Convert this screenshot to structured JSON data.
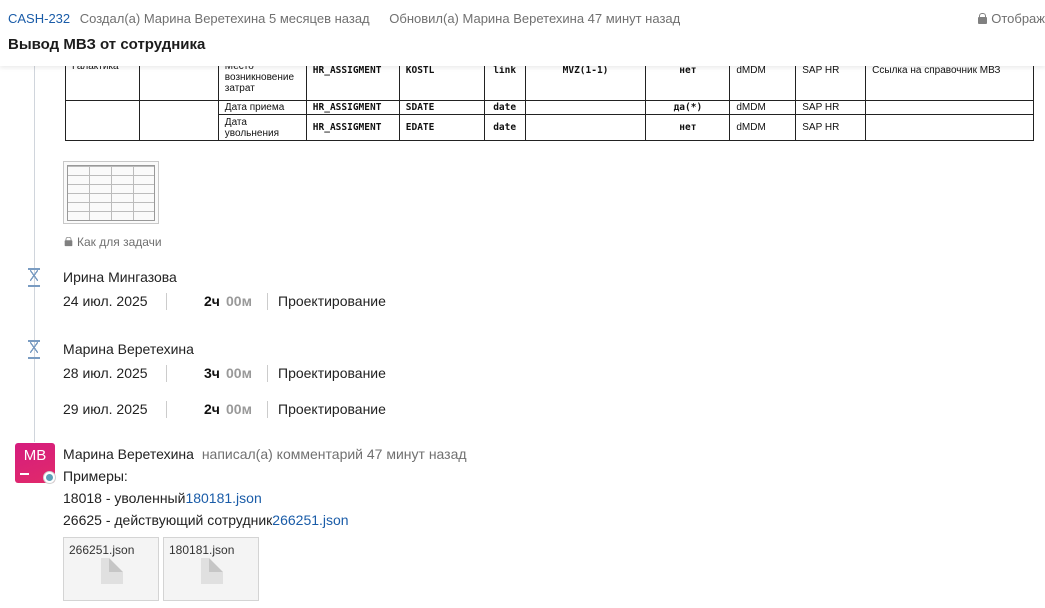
{
  "header": {
    "issue_key": "CASH-232",
    "created": "Создал(а) Марина Веретехина 5 месяцев назад",
    "updated": "Обновил(а) Марина Веретехина 47 минут назад",
    "visibility": "Отображ",
    "title": "Вывод МВЗ от сотрудника"
  },
  "embedded_table": {
    "rows": [
      {
        "system": "Галактика",
        "field": "Место возникновение затрат",
        "table": "HR_ASSIGMENT",
        "column": "KOSTL",
        "type": "link",
        "ref": "MVZ(1-1)",
        "required": "нет",
        "source": "dMDM",
        "origin": "SAP HR",
        "comment": "Ссылка на справочник МВЗ"
      },
      {
        "system": "",
        "field": "Дата приема",
        "table": "HR_ASSIGMENT",
        "column": "SDATE",
        "type": "date",
        "ref": "",
        "required": "да(*)",
        "source": "dMDM",
        "origin": "SAP HR",
        "comment": ""
      },
      {
        "system": "",
        "field": "Дата увольнения",
        "table": "HR_ASSIGMENT",
        "column": "EDATE",
        "type": "date",
        "ref": "",
        "required": "нет",
        "source": "dMDM",
        "origin": "SAP HR",
        "comment": ""
      }
    ]
  },
  "attachment_note": "Как для задачи",
  "worklogs": [
    {
      "author": "Ирина Мингазова",
      "entries": [
        {
          "date": "24 июл. 2025",
          "hours": "2ч",
          "minutes": "00м",
          "activity": "Проектирование"
        }
      ]
    },
    {
      "author": "Марина Веретехина",
      "entries": [
        {
          "date": "28 июл. 2025",
          "hours": "3ч",
          "minutes": "00м",
          "activity": "Проектирование"
        },
        {
          "date": "29 июл. 2025",
          "hours": "2ч",
          "minutes": "00м",
          "activity": "Проектирование"
        }
      ]
    }
  ],
  "comment": {
    "avatar_initials": "МВ",
    "author": "Марина Веретехина",
    "action": "написал(а) комментарий 47 минут назад",
    "line1": "Примеры:",
    "line2_text": "18018 - уволенный",
    "line2_link": "180181.json",
    "line3_text": "26625 - действующий сотрудник",
    "line3_link": "266251.json",
    "attachments": [
      "266251.json",
      "180181.json"
    ]
  },
  "icons": {
    "lock": "lock-icon",
    "worklog": "hourglass-icon",
    "file": "file-icon"
  },
  "colors": {
    "link": "#1a5ca8",
    "avatar": "#d51c7e",
    "timeline_icon": "#7a9cc2"
  }
}
